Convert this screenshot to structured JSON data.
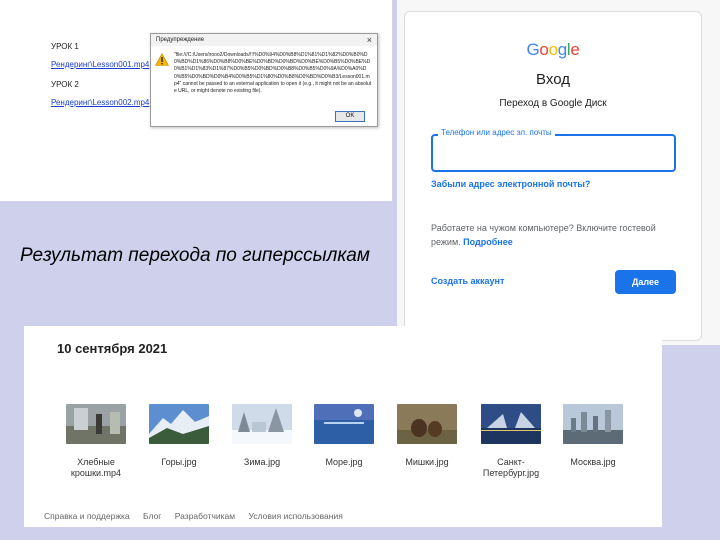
{
  "explorer": {
    "lesson1_heading": "УРОК 1",
    "lesson1_link": "Рендеринг\\Lesson001.mp4",
    "lesson2_heading": "УРОК 2",
    "lesson2_link": "Рендеринг\\Lesson002.mp4"
  },
  "dialog": {
    "title": "Предупреждение",
    "close": "×",
    "message": "\"file:///C:/Users/irooo2/Downloads/!!!%D0%94%D0%B8%D1%81%D1%82%D0%B0%D0%BD%D1%86%D0%B8%D0%BE%D0%BD%D0%BD%D0%BE%D0%B5%D0%BE%D0%B1%D1%83%D1%87%D0%B5%D0%BD%D0%B8%D0%B5%D0%9A%D0%A0%D0%B5%D0%BD%D0%B4%D0%B5%D1%80%D0%B8%D0%BD%D0%B3/Lesson001.mp4\" cannot be passed to an external application to open it (e.g., it might not be an absolute URL, or might denote no existing file).",
    "ok_label": "OK",
    "icon": "warning-icon"
  },
  "google": {
    "logo_letters": [
      {
        "ch": "G",
        "color": "#4285f4"
      },
      {
        "ch": "o",
        "color": "#ea4335"
      },
      {
        "ch": "o",
        "color": "#fbbc05"
      },
      {
        "ch": "g",
        "color": "#4285f4"
      },
      {
        "ch": "l",
        "color": "#34a853"
      },
      {
        "ch": "e",
        "color": "#ea4335"
      }
    ],
    "title": "Вход",
    "subtitle": "Переход в Google Диск",
    "input_label": "Телефон или адрес эл. почты",
    "input_value": "",
    "forgot_link": "Забыли адрес электронной почты?",
    "guest_text": "Работаете на чужом компьютере? Включите гостевой режим.",
    "more_link": "Подробнее",
    "create_account": "Создать аккаунт",
    "next_button": "Далее",
    "accent": "#1a73e8"
  },
  "caption": "Результат перехода по гиперссылкам",
  "drive": {
    "date": "10 сентября 2021",
    "files": [
      {
        "name": "Хлебные крошки.mp4",
        "type": "video"
      },
      {
        "name": "Горы.jpg",
        "type": "image"
      },
      {
        "name": "Зима.jpg",
        "type": "image"
      },
      {
        "name": "Море.jpg",
        "type": "image"
      },
      {
        "name": "Мишки.jpg",
        "type": "image"
      },
      {
        "name": "Санкт-Петербург.jpg",
        "type": "image"
      },
      {
        "name": "Москва.jpg",
        "type": "image"
      }
    ],
    "footer": [
      "Справка и поддержка",
      "Блог",
      "Разработчикам",
      "Условия использования"
    ]
  }
}
